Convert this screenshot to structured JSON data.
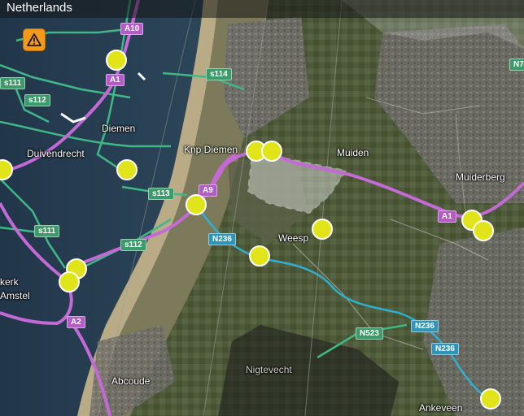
{
  "header": {
    "region": "Netherlands"
  },
  "alert": {
    "icon": "warning-triangle-icon",
    "color": "#f39a1a"
  },
  "colors": {
    "motorway": "#c46ad6",
    "s_road": "#3fb887",
    "n_road": "#2fb0d0",
    "camera": "#e2e41a"
  },
  "places": {
    "netherlands_top": "Netherlands",
    "diemen": "Diemen",
    "duivendrecht": "Duivendrecht",
    "knp_diemen": "Knp Diemen",
    "muiden": "Muiden",
    "muiderberg": "Muiderberg",
    "weesp": "Weesp",
    "ouderkerk": "kerk",
    "amstel": "Amstel",
    "abcoude": "Abcoude",
    "nigtevecht": "Nigtevecht",
    "ankeveen": "Ankeveen"
  },
  "roads": {
    "a10": "A10",
    "a1_west": "A1",
    "a1_east": "A1",
    "a9": "A9",
    "a2": "A2",
    "s114": "s114",
    "s111a": "s111",
    "s112a": "s112",
    "s113": "s113",
    "s111b": "s111",
    "s112b": "s112",
    "n236a": "N236",
    "n236b": "N236",
    "n236c": "N236",
    "n523": "N523",
    "n7": "N7"
  },
  "cameras": {
    "count": 14
  }
}
